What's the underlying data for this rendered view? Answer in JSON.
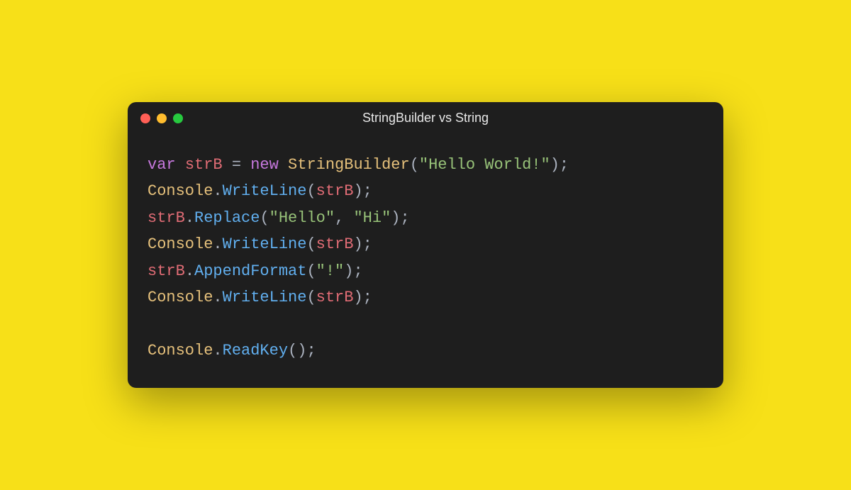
{
  "window": {
    "title": "StringBuilder vs String",
    "traffic": [
      "close",
      "minimize",
      "zoom"
    ]
  },
  "code": {
    "lines": [
      [
        {
          "cls": "kw",
          "t": "var"
        },
        {
          "cls": "punc",
          "t": " "
        },
        {
          "cls": "var",
          "t": "strB"
        },
        {
          "cls": "punc",
          "t": " = "
        },
        {
          "cls": "kw",
          "t": "new"
        },
        {
          "cls": "punc",
          "t": " "
        },
        {
          "cls": "cls",
          "t": "StringBuilder"
        },
        {
          "cls": "punc",
          "t": "("
        },
        {
          "cls": "str",
          "t": "\"Hello World!\""
        },
        {
          "cls": "punc",
          "t": ");"
        }
      ],
      [
        {
          "cls": "cls",
          "t": "Console"
        },
        {
          "cls": "punc",
          "t": "."
        },
        {
          "cls": "func",
          "t": "WriteLine"
        },
        {
          "cls": "punc",
          "t": "("
        },
        {
          "cls": "var",
          "t": "strB"
        },
        {
          "cls": "punc",
          "t": ");"
        }
      ],
      [
        {
          "cls": "var",
          "t": "strB"
        },
        {
          "cls": "punc",
          "t": "."
        },
        {
          "cls": "func",
          "t": "Replace"
        },
        {
          "cls": "punc",
          "t": "("
        },
        {
          "cls": "str",
          "t": "\"Hello\""
        },
        {
          "cls": "punc",
          "t": ", "
        },
        {
          "cls": "str",
          "t": "\"Hi\""
        },
        {
          "cls": "punc",
          "t": ");"
        }
      ],
      [
        {
          "cls": "cls",
          "t": "Console"
        },
        {
          "cls": "punc",
          "t": "."
        },
        {
          "cls": "func",
          "t": "WriteLine"
        },
        {
          "cls": "punc",
          "t": "("
        },
        {
          "cls": "var",
          "t": "strB"
        },
        {
          "cls": "punc",
          "t": ");"
        }
      ],
      [
        {
          "cls": "var",
          "t": "strB"
        },
        {
          "cls": "punc",
          "t": "."
        },
        {
          "cls": "func",
          "t": "AppendFormat"
        },
        {
          "cls": "punc",
          "t": "("
        },
        {
          "cls": "str",
          "t": "\"!\""
        },
        {
          "cls": "punc",
          "t": ");"
        }
      ],
      [
        {
          "cls": "cls",
          "t": "Console"
        },
        {
          "cls": "punc",
          "t": "."
        },
        {
          "cls": "func",
          "t": "WriteLine"
        },
        {
          "cls": "punc",
          "t": "("
        },
        {
          "cls": "var",
          "t": "strB"
        },
        {
          "cls": "punc",
          "t": ");"
        }
      ],
      [],
      [
        {
          "cls": "cls",
          "t": "Console"
        },
        {
          "cls": "punc",
          "t": "."
        },
        {
          "cls": "func",
          "t": "ReadKey"
        },
        {
          "cls": "punc",
          "t": "();"
        }
      ]
    ]
  }
}
